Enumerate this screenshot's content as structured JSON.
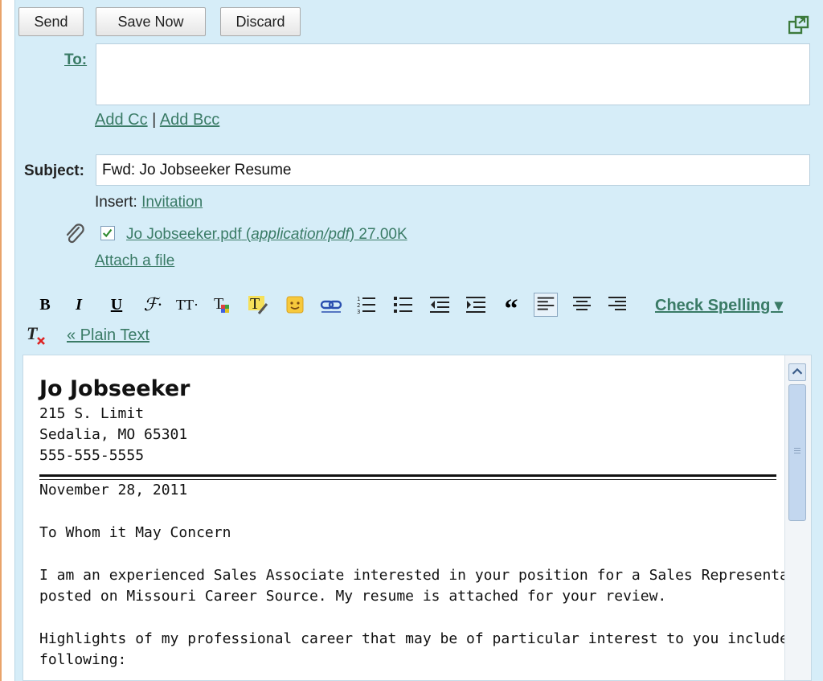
{
  "toolbar": {
    "send_label": "Send",
    "save_label": "Save Now",
    "discard_label": "Discard"
  },
  "header": {
    "to_label": "To:",
    "to_value": "",
    "add_cc": "Add Cc",
    "separator": "|",
    "add_bcc": "Add Bcc",
    "subject_label": "Subject:",
    "subject_value": "Fwd: Jo Jobseeker Resume",
    "insert_label": "Insert:",
    "insert_link": "Invitation"
  },
  "attachment": {
    "filename": "Jo Jobseeker.pdf",
    "open_paren": " (",
    "mimetype": "application/pdf",
    "close_paren_size": ") 27.00K",
    "checked": true,
    "attach_link": "Attach a file"
  },
  "format_toolbar": {
    "bold": "B",
    "italic": "I",
    "underline": "U",
    "font": "ℱ·",
    "size": "TT·",
    "check_spelling": "Check Spelling ▾",
    "plain_text": "« Plain Text",
    "icons": [
      "bold-icon",
      "italic-icon",
      "underline-icon",
      "font-icon",
      "font-size-icon",
      "text-color-icon",
      "highlight-icon",
      "emoticon-icon",
      "link-icon",
      "numbered-list-icon",
      "bulleted-list-icon",
      "indent-less-icon",
      "indent-more-icon",
      "quote-icon",
      "align-left-icon",
      "align-center-icon",
      "align-right-icon",
      "remove-formatting-icon"
    ]
  },
  "message": {
    "name": "Jo Jobseeker",
    "address_line1": "215 S. Limit",
    "address_line2": "Sedalia, MO 65301",
    "phone": "555-555-5555",
    "date": "November 28, 2011",
    "greeting": "To Whom it May Concern",
    "para1_line1": "I am an experienced Sales Associate interested in your position for a Sales Representative",
    "para1_line2": "posted on Missouri Career Source. My resume is attached for your review.",
    "para2_line1": "Highlights of my professional career that may be of particular interest to you include the",
    "para2_line2": "following:"
  },
  "colors": {
    "compose_bg": "#d6edf8",
    "link": "#3a7b66",
    "scrollbar_thumb": "#c3d7ef"
  }
}
